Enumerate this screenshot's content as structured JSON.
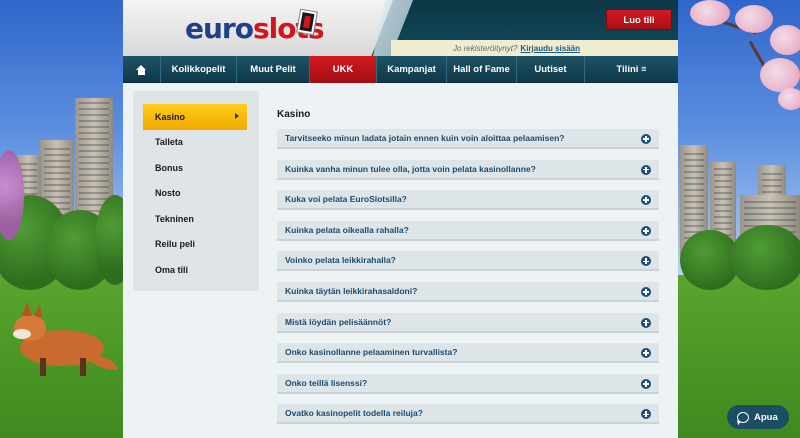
{
  "header": {
    "logo_part1": "euro",
    "logo_part2": "slots",
    "cta_label": "Luo tili",
    "login_prompt": "Jo rekisteröitynyt?",
    "login_link": "Kirjaudu sisään"
  },
  "nav": {
    "home_icon": "home-icon",
    "items": [
      {
        "label": "Kolikkopelit"
      },
      {
        "label": "Muut Pelit"
      },
      {
        "label": "UKK"
      },
      {
        "label": "Kampanjat"
      },
      {
        "label": "Hall of Fame"
      },
      {
        "label": "Uutiset"
      },
      {
        "label": "Tilini ≡"
      }
    ],
    "active_label": "UKK"
  },
  "sidebar": {
    "items": [
      {
        "label": "Kasino"
      },
      {
        "label": "Talleta"
      },
      {
        "label": "Bonus"
      },
      {
        "label": "Nosto"
      },
      {
        "label": "Tekninen"
      },
      {
        "label": "Reilu peli"
      },
      {
        "label": "Oma tili"
      }
    ],
    "active_label": "Kasino"
  },
  "faq": {
    "title": "Kasino",
    "questions": [
      "Tarvitseeko minun ladata jotain ennen kuin voin aloittaa pelaamisen?",
      "Kuinka vanha minun tulee olla, jotta voin pelata kasinollanne?",
      "Kuka voi pelata EuroSlotsilla?",
      "Kuinka pelata oikealla rahalla?",
      "Voinko pelata leikkirahalla?",
      "Kuinka täytän leikkirahasaldoni?",
      "Mistä löydän pelisäännöt?",
      "Onko kasinollanne pelaaminen turvallista?",
      "Onko teillä lisenssi?",
      "Ovatko kasinopelit todella reiluja?"
    ]
  },
  "help": {
    "label": "Apua",
    "icon": "chat-icon"
  },
  "colors": {
    "brand_blue": "#1f3f86",
    "brand_red": "#d2141c",
    "nav_bg": "#0f3a4a",
    "active_sidebar": "#f0a900",
    "faq_text": "#1e4a6e"
  }
}
